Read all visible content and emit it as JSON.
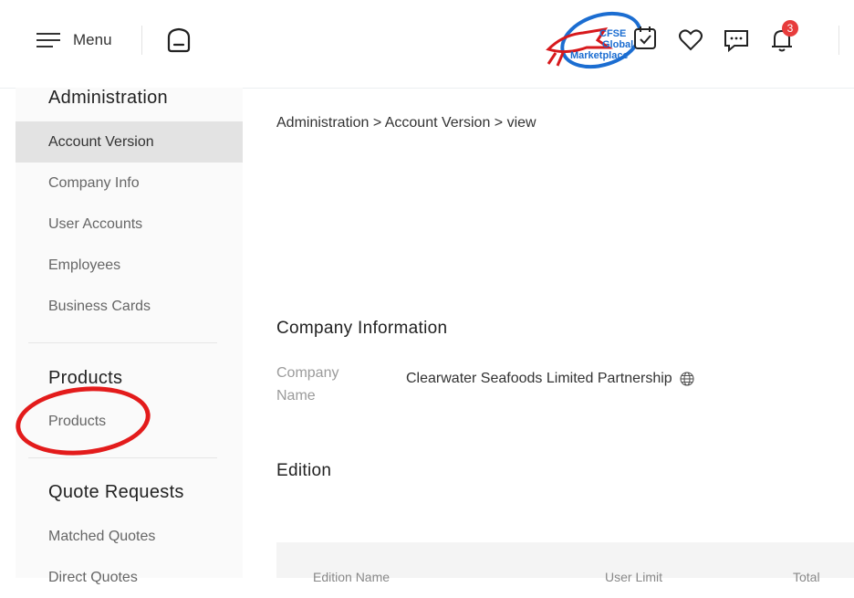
{
  "header": {
    "menu_label": "Menu",
    "logo": {
      "line1": "CFSE",
      "line2": "Global",
      "line3": "Marketplace"
    },
    "notification_count": "3",
    "colors": {
      "badge": "#e73c3c",
      "logo_blue": "#1b6dd1",
      "logo_red": "#d7191c"
    }
  },
  "sidebar": {
    "sections": [
      {
        "title": "Administration",
        "items": [
          "Account Version",
          "Company Info",
          "User Accounts",
          "Employees",
          "Business Cards"
        ]
      },
      {
        "title": "Products",
        "items": [
          "Products"
        ]
      },
      {
        "title": "Quote Requests",
        "items": [
          "Matched Quotes",
          "Direct Quotes"
        ]
      }
    ],
    "active_item": "Account Version"
  },
  "main": {
    "breadcrumb": "Administration > Account Version > view",
    "company_info_title": "Company Information",
    "company_name_label": "Company Name",
    "company_name_value": "Clearwater Seafoods Limited Partnership",
    "edition_title": "Edition",
    "table_headers": [
      "Edition Name",
      "User Limit",
      "Total"
    ]
  },
  "annotation": {
    "color": "#e31b1b"
  }
}
